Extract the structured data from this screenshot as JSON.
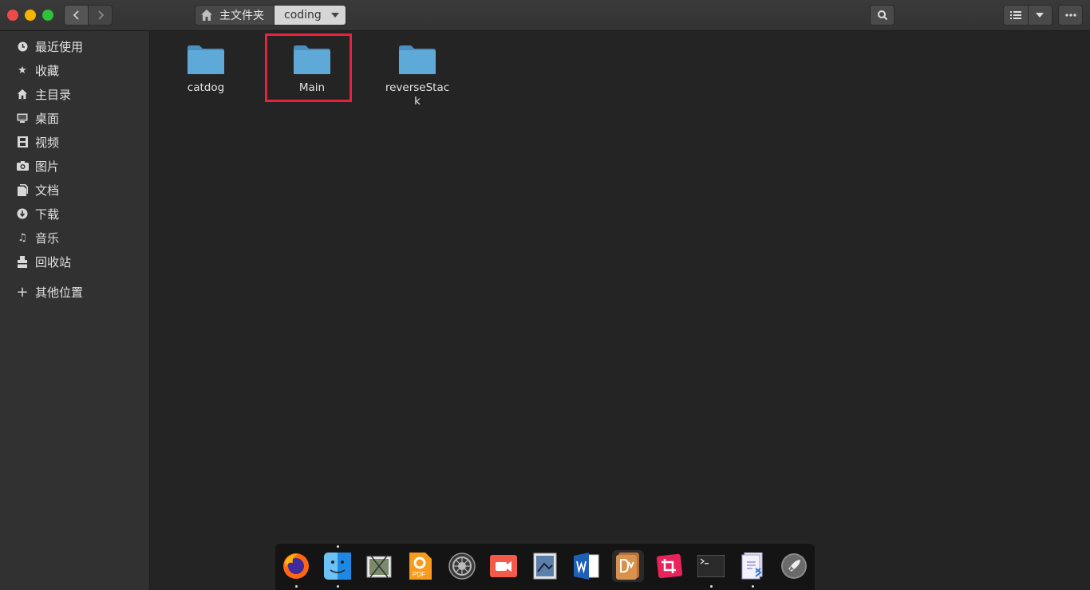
{
  "window": {
    "controls": [
      "close",
      "minimize",
      "maximize"
    ]
  },
  "header": {
    "back_icon": "chevron-left-icon",
    "forward_icon": "chevron-right-icon",
    "path": {
      "home_label": "主文件夹",
      "current_label": "coding"
    }
  },
  "sidebar": {
    "items": [
      {
        "label": "最近使用",
        "icon": "clock-icon"
      },
      {
        "label": "收藏",
        "icon": "star-icon"
      },
      {
        "label": "主目录",
        "icon": "home-icon"
      },
      {
        "label": "桌面",
        "icon": "desktop-icon"
      },
      {
        "label": "视频",
        "icon": "film-icon"
      },
      {
        "label": "图片",
        "icon": "camera-icon"
      },
      {
        "label": "文档",
        "icon": "document-icon"
      },
      {
        "label": "下载",
        "icon": "download-icon"
      },
      {
        "label": "音乐",
        "icon": "music-icon"
      },
      {
        "label": "回收站",
        "icon": "trash-icon"
      },
      {
        "label": "其他位置",
        "icon": "plus-icon"
      }
    ]
  },
  "files": [
    {
      "name": "catdog",
      "type": "folder"
    },
    {
      "name": "Main",
      "type": "folder",
      "highlighted": true
    },
    {
      "name": "reverseStack",
      "type": "folder"
    }
  ],
  "dock": {
    "apps": [
      "firefox",
      "finder",
      "screenshot",
      "pdf-reader",
      "settings",
      "screen-recorder",
      "preview",
      "word",
      "dictionary",
      "crop-tool",
      "terminal",
      "vscode",
      "launchpad"
    ],
    "pdf_badge": "PDF"
  },
  "colors": {
    "folder": "#5aa3d4",
    "highlight": "#e8223c",
    "background": "#242424",
    "sidebar": "#313131"
  }
}
